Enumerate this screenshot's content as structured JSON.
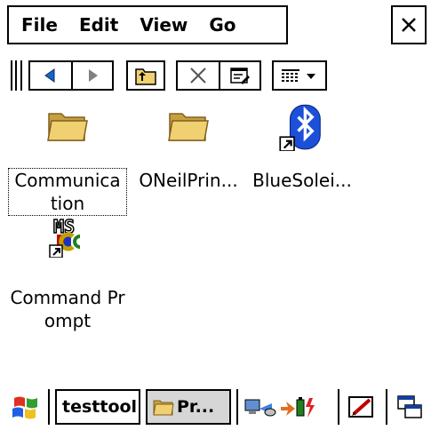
{
  "menu": {
    "items": [
      "File",
      "Edit",
      "View",
      "Go"
    ],
    "close_label": "✕"
  },
  "toolbar": {
    "buttons": [
      "back-icon",
      "forward-icon",
      "up-folder-icon",
      "delete-icon",
      "properties-icon",
      "view-options-icon"
    ]
  },
  "files": [
    {
      "name": "Communication",
      "label": "Communica tion",
      "icon": "folder-icon",
      "selected": true
    },
    {
      "name": "ONeilPrin...",
      "label": "ONeilPrin...",
      "icon": "folder-icon",
      "selected": false
    },
    {
      "name": "BlueSolei...",
      "label": "BlueSolei...",
      "icon": "bluetooth-shortcut-icon",
      "selected": false
    },
    {
      "name": "Command Prompt",
      "label": "Command Prompt",
      "icon": "ms-dos-shortcut-icon",
      "selected": false
    }
  ],
  "taskbar": {
    "start_icon": "windows-flag-icon",
    "tasks": [
      {
        "label": "testtool",
        "active": false
      },
      {
        "label": "Pr...",
        "active": true
      }
    ],
    "tray_icons": [
      "network-icon",
      "battery-power-icon",
      "input-panel-icon",
      "desktop-icon"
    ]
  },
  "colors": {
    "folder": "#f0d070",
    "bluetooth": "#1c50d8",
    "back_arrow": "#1565c0",
    "forward_arrow": "#808080",
    "active_task": "#d6d6d6"
  }
}
